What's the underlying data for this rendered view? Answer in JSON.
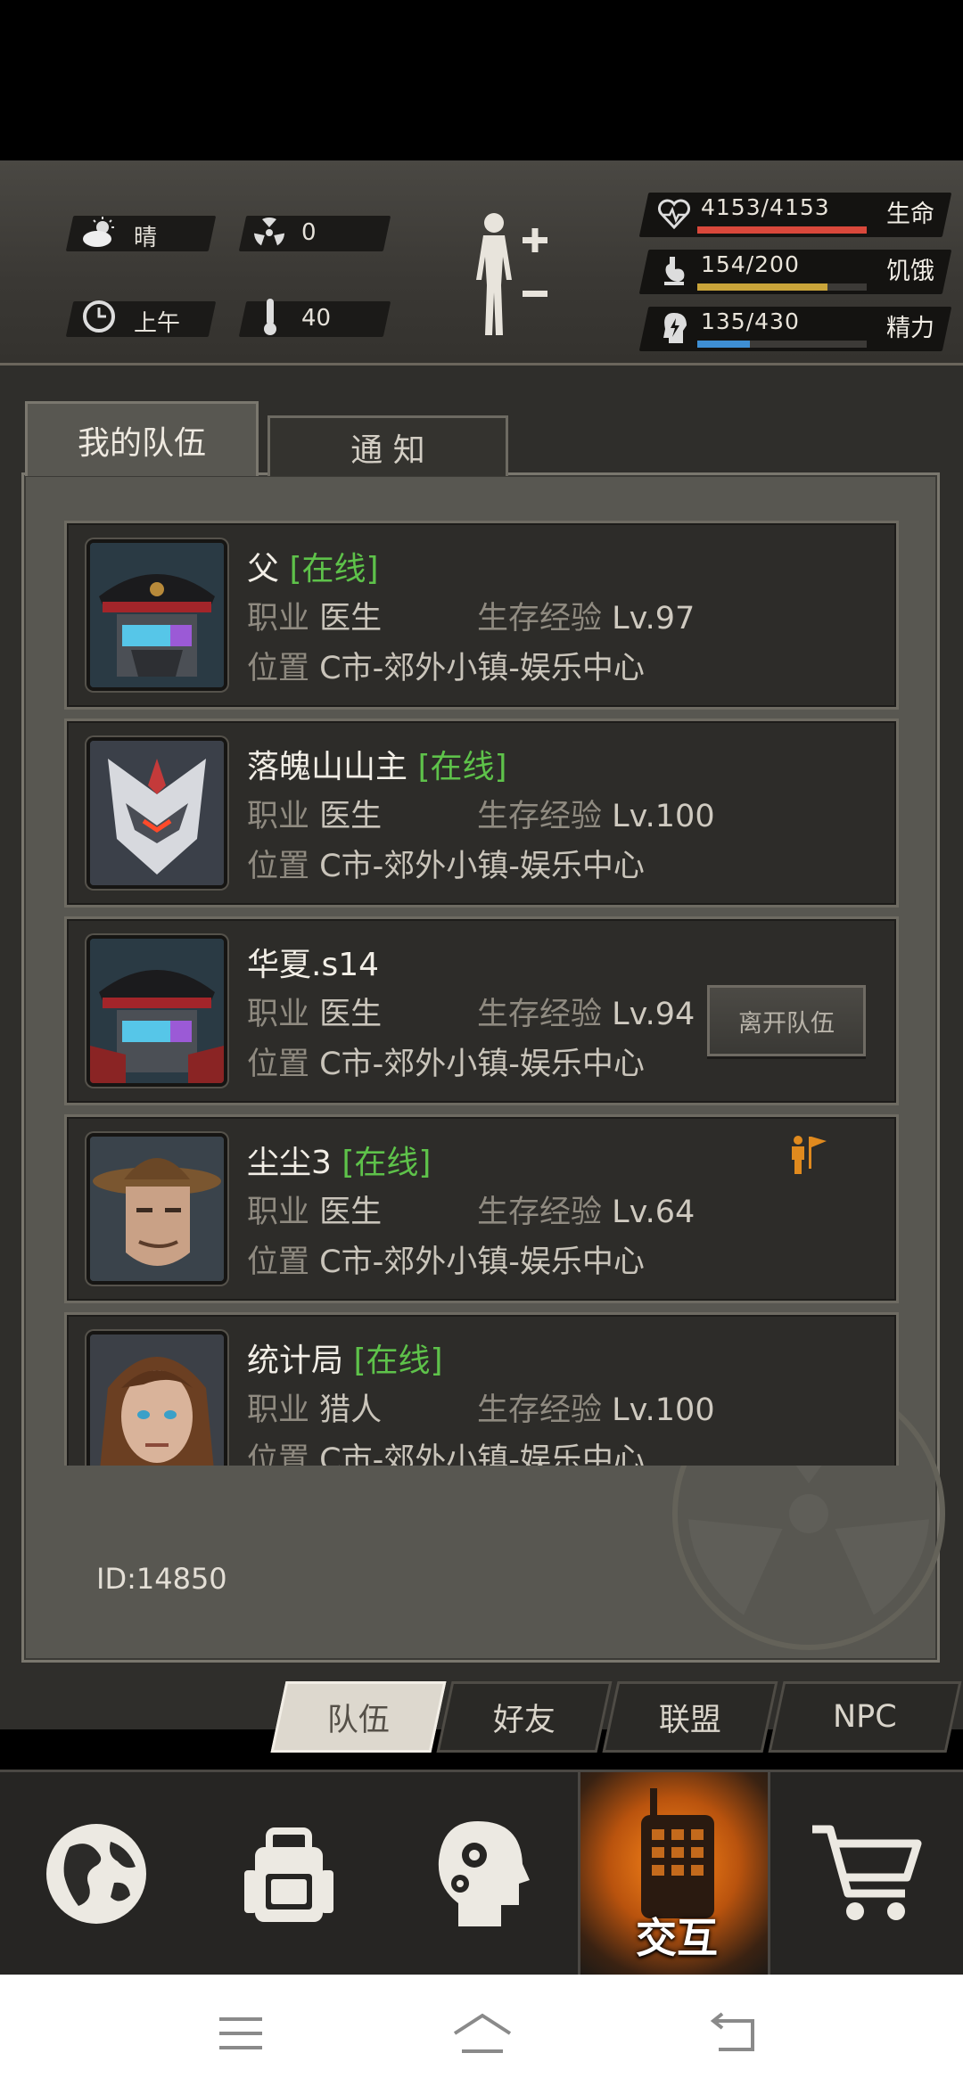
{
  "status": {
    "weather": "晴",
    "radiation": "0",
    "time": "上午",
    "temperature": "40",
    "stats": [
      {
        "value": "4153/4153",
        "label": "生命",
        "fraction": 1.0,
        "color": "#d9483b"
      },
      {
        "value": "154/200",
        "label": "饥饿",
        "fraction": 0.77,
        "color": "#c9a43a"
      },
      {
        "value": "135/430",
        "label": "精力",
        "fraction": 0.31,
        "color": "#3e8fd4"
      }
    ]
  },
  "tabs": {
    "my_team": "我的队伍",
    "notice": "通 知"
  },
  "labels": {
    "job": "职业",
    "pos": "位置",
    "exp": "生存经验",
    "online": "[在线]"
  },
  "members": [
    {
      "name": "父",
      "online": true,
      "job": "医生",
      "level": "Lv.97",
      "location": "C市-郊外小镇-娱乐中心"
    },
    {
      "name": "落魄山山主",
      "online": true,
      "job": "医生",
      "level": "Lv.100",
      "location": "C市-郊外小镇-娱乐中心"
    },
    {
      "name": "华夏.s14",
      "online": false,
      "job": "医生",
      "level": "Lv.94",
      "location": "C市-郊外小镇-娱乐中心",
      "action": "离开队伍"
    },
    {
      "name": "尘尘3",
      "online": true,
      "job": "医生",
      "level": "Lv.64",
      "location": "C市-郊外小镇-娱乐中心",
      "leader": true
    },
    {
      "name": "统计局",
      "online": true,
      "job": "猎人",
      "level": "Lv.100",
      "location": "C市-郊外小镇-娱乐中心"
    }
  ],
  "team_id": "ID:14850",
  "subtabs": [
    "队伍",
    "好友",
    "联盟",
    "NPC"
  ],
  "nav": {
    "interact": "交互"
  }
}
